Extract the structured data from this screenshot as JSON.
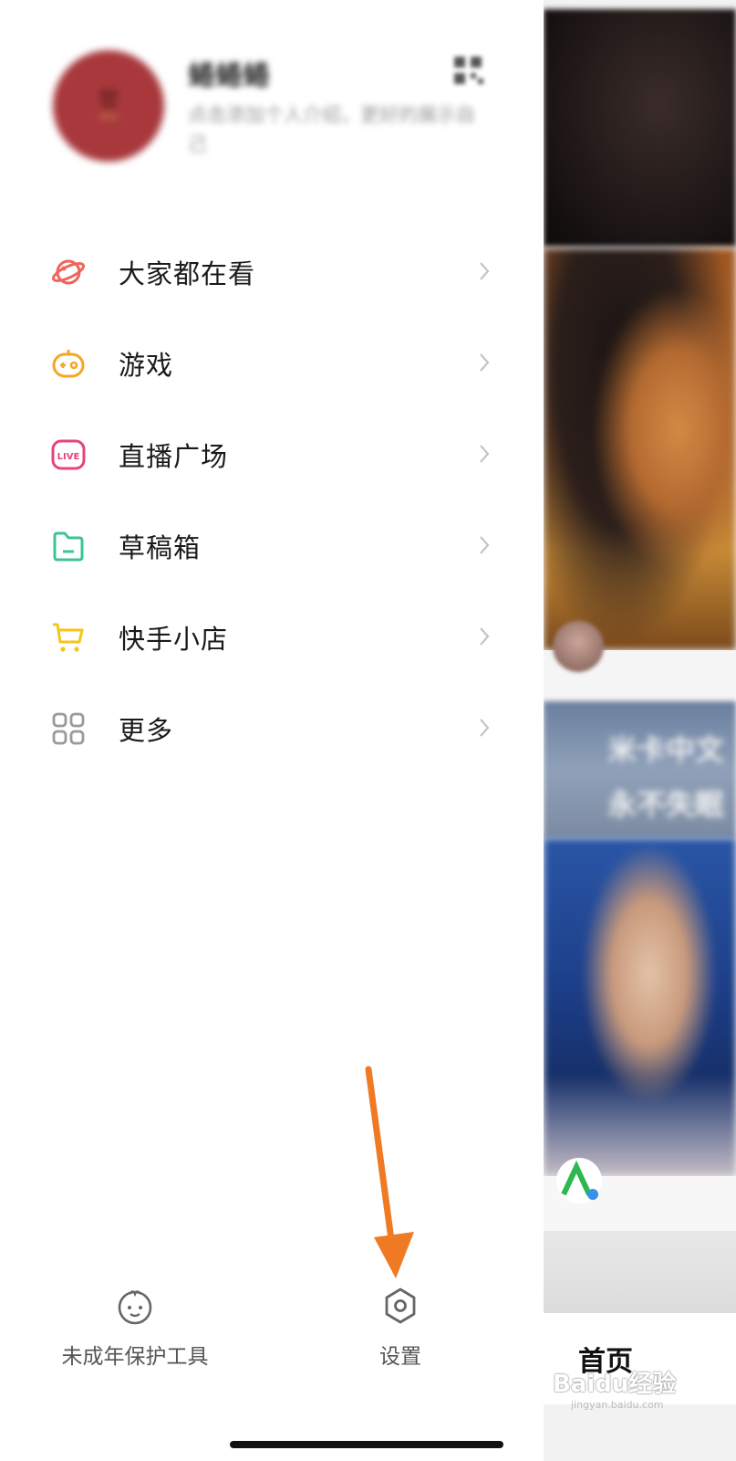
{
  "profile": {
    "name": "蜷蜷蜷",
    "bio": "点击添加个人介绍，更好的展示自己",
    "avatar_text": "廿",
    "avatar_sub": "shu"
  },
  "menu": [
    {
      "label": "大家都在看",
      "icon": "planet-icon",
      "color": "#f0645a"
    },
    {
      "label": "游戏",
      "icon": "game-controller-icon",
      "color": "#f5a623"
    },
    {
      "label": "直播广场",
      "icon": "live-icon",
      "color": "#e8437b"
    },
    {
      "label": "草稿箱",
      "icon": "folder-icon",
      "color": "#3cc39a"
    },
    {
      "label": "快手小店",
      "icon": "cart-icon",
      "color": "#f5c518"
    },
    {
      "label": "更多",
      "icon": "grid-icon",
      "color": "#9a9a9a"
    }
  ],
  "bottom": {
    "minor_protection": "未成年保护工具",
    "settings": "设置"
  },
  "annotation": {
    "arrow_color": "#f07a23"
  },
  "background_feed": {
    "overlay_text_line1": "米卡中文",
    "overlay_text_line2": "永不失眠",
    "nav_home": "首页",
    "watermark": "Baidu经验",
    "watermark_sub": "jingyan.baidu.com"
  }
}
